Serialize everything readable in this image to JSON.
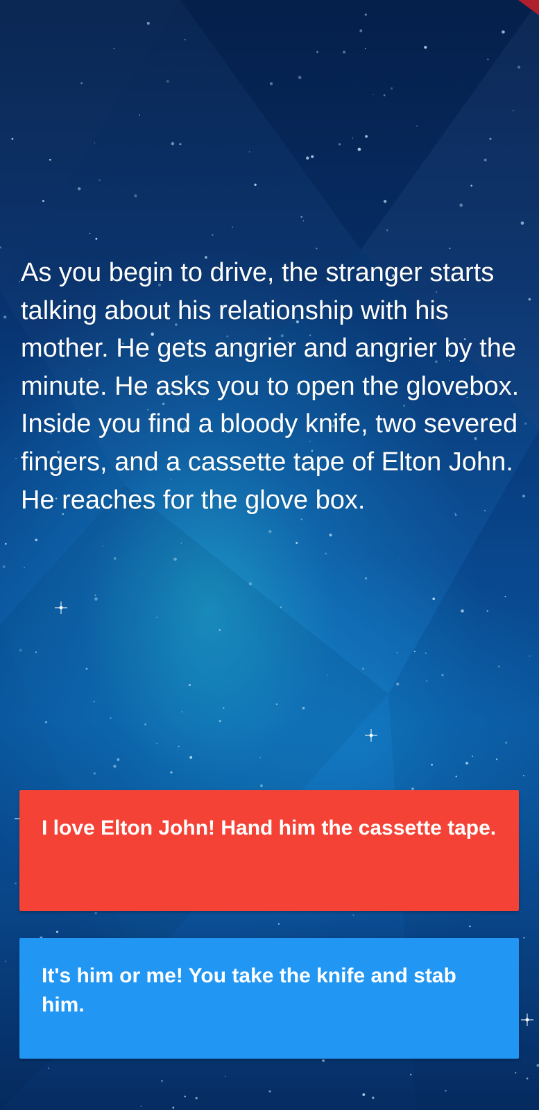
{
  "story": {
    "text": "As you begin to drive, the stranger starts talking about his relationship with his mother. He gets angrier and angrier by the minute. He asks you to open the glovebox. Inside you find a bloody knife, two severed fingers, and a cassette tape of Elton John. He reaches for the glove box."
  },
  "choices": [
    {
      "label": "I love Elton John! Hand him the cassette tape.",
      "color": "#f44336"
    },
    {
      "label": "It's him or me! You take the knife and stab him.",
      "color": "#2196f3"
    }
  ],
  "theme": {
    "background_top": "#06224f",
    "background_glow": "#28c8e6",
    "corner_accent": "#b0202c"
  }
}
